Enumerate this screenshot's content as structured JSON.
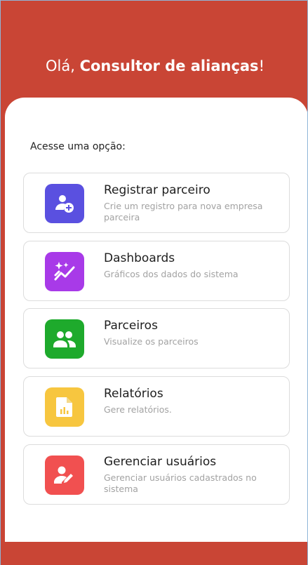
{
  "header": {
    "greeting_prefix": "Olá, ",
    "user_role": "Consultor de alianças",
    "greeting_suffix": "!"
  },
  "main": {
    "prompt": "Acesse uma opção:",
    "options": [
      {
        "title": "Registrar parceiro",
        "description": "Crie um registro para nova empresa parceira",
        "icon": "add-user-icon",
        "color": "#5a50e0"
      },
      {
        "title": "Dashboards",
        "description": "Gráficos dos dados do sistema",
        "icon": "sparkle-chart-icon",
        "color": "#a83ae8"
      },
      {
        "title": "Parceiros",
        "description": "Visualize os parceiros",
        "icon": "group-icon",
        "color": "#1eaa2c"
      },
      {
        "title": "Relatórios",
        "description": "Gere relatórios.",
        "icon": "report-icon",
        "color": "#f7c63f"
      },
      {
        "title": "Gerenciar usuários",
        "description": "Gerenciar usuários cadastrados no sistema",
        "icon": "edit-user-icon",
        "color": "#f15050"
      }
    ]
  },
  "colors": {
    "brand": "#c94535",
    "card_border": "#dcdcdc"
  }
}
